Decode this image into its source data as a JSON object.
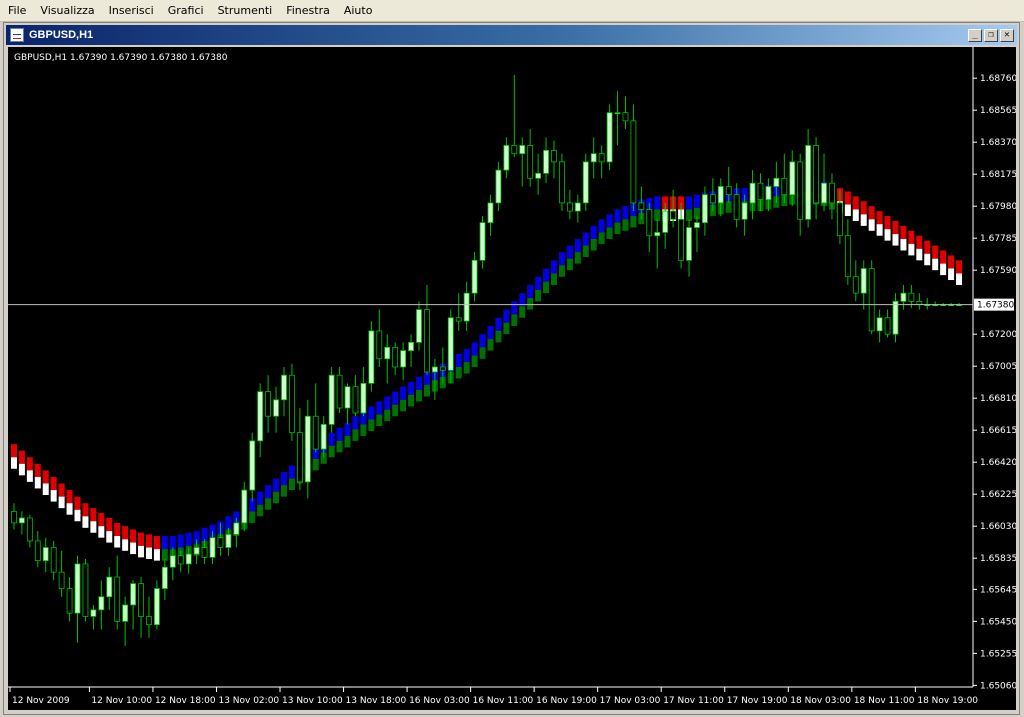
{
  "menu": {
    "items": [
      {
        "label": "File",
        "name": "menu-file"
      },
      {
        "label": "Visualizza",
        "name": "menu-visualizza"
      },
      {
        "label": "Inserisci",
        "name": "menu-inserisci"
      },
      {
        "label": "Grafici",
        "name": "menu-grafici"
      },
      {
        "label": "Strumenti",
        "name": "menu-strumenti"
      },
      {
        "label": "Finestra",
        "name": "menu-finestra"
      },
      {
        "label": "Aiuto",
        "name": "menu-aiuto"
      }
    ]
  },
  "window": {
    "title": "GBPUSD,H1",
    "minimize_label": "_",
    "restore_label": "❐",
    "close_label": "✕",
    "icon": "chart-window-icon"
  },
  "chart_data": {
    "type": "candlestick",
    "symbol_label": "GBPUSD,H1",
    "info_line": "GBPUSD,H1  1.67390 1.67390 1.67380 1.67380",
    "current_price": "1.67380",
    "current_price_value": 1.6738,
    "ylim": [
      1.6505,
      1.6895
    ],
    "y_ticks": [
      {
        "label": "1.68760",
        "value": 1.6876
      },
      {
        "label": "1.68565",
        "value": 1.68565
      },
      {
        "label": "1.68370",
        "value": 1.6837
      },
      {
        "label": "1.68175",
        "value": 1.68175
      },
      {
        "label": "1.67980",
        "value": 1.6798
      },
      {
        "label": "1.67785",
        "value": 1.67785
      },
      {
        "label": "1.67590",
        "value": 1.6759
      },
      {
        "label": "1.67200",
        "value": 1.672
      },
      {
        "label": "1.67005",
        "value": 1.67005
      },
      {
        "label": "1.66810",
        "value": 1.6681
      },
      {
        "label": "1.66615",
        "value": 1.66615
      },
      {
        "label": "1.66420",
        "value": 1.6642
      },
      {
        "label": "1.66225",
        "value": 1.66225
      },
      {
        "label": "1.66030",
        "value": 1.6603
      },
      {
        "label": "1.65835",
        "value": 1.65835
      },
      {
        "label": "1.65645",
        "value": 1.65645
      },
      {
        "label": "1.65450",
        "value": 1.6545
      },
      {
        "label": "1.65255",
        "value": 1.65255
      },
      {
        "label": "1.65060",
        "value": 1.6506
      }
    ],
    "x_ticks": [
      {
        "label": "12 Nov 2009",
        "bar": 0
      },
      {
        "label": "12 Nov 10:00",
        "bar": 10
      },
      {
        "label": "12 Nov 18:00",
        "bar": 18
      },
      {
        "label": "13 Nov 02:00",
        "bar": 26
      },
      {
        "label": "13 Nov 10:00",
        "bar": 34
      },
      {
        "label": "13 Nov 18:00",
        "bar": 42
      },
      {
        "label": "16 Nov 03:00",
        "bar": 50
      },
      {
        "label": "16 Nov 11:00",
        "bar": 58
      },
      {
        "label": "16 Nov 19:00",
        "bar": 66
      },
      {
        "label": "17 Nov 03:00",
        "bar": 74
      },
      {
        "label": "17 Nov 11:00",
        "bar": 82
      },
      {
        "label": "17 Nov 19:00",
        "bar": 90
      },
      {
        "label": "18 Nov 03:00",
        "bar": 98
      },
      {
        "label": "18 Nov 11:00",
        "bar": 106
      },
      {
        "label": "18 Nov 19:00",
        "bar": 114
      }
    ],
    "bar_count": 120,
    "colors": {
      "background": "#000000",
      "candle_wick": "#00c000",
      "bull_body": "#ccffcc",
      "bear_body": "#000000",
      "band_red": "#e00000",
      "band_blue": "#0000e0",
      "band_green": "#007000",
      "band_white": "#ffffff",
      "axis_text": "#ffffff",
      "price_line": "#c0c0c0"
    },
    "candles": [
      [
        1.6612,
        1.6617,
        1.6601,
        1.6605
      ],
      [
        1.6605,
        1.6612,
        1.6598,
        1.6608
      ],
      [
        1.6608,
        1.661,
        1.659,
        1.6594
      ],
      [
        1.6594,
        1.66,
        1.6578,
        1.6582
      ],
      [
        1.6582,
        1.6596,
        1.6575,
        1.659
      ],
      [
        1.659,
        1.6594,
        1.657,
        1.6575
      ],
      [
        1.6575,
        1.6588,
        1.656,
        1.6565
      ],
      [
        1.6565,
        1.6572,
        1.6545,
        1.655
      ],
      [
        1.655,
        1.6585,
        1.6532,
        1.658
      ],
      [
        1.658,
        1.6583,
        1.6545,
        1.6548
      ],
      [
        1.6548,
        1.6555,
        1.654,
        1.6552
      ],
      [
        1.6552,
        1.657,
        1.654,
        1.656
      ],
      [
        1.656,
        1.6578,
        1.6552,
        1.6572
      ],
      [
        1.6572,
        1.6585,
        1.654,
        1.6545
      ],
      [
        1.6545,
        1.656,
        1.653,
        1.6555
      ],
      [
        1.6555,
        1.657,
        1.654,
        1.6568
      ],
      [
        1.6568,
        1.6572,
        1.6535,
        1.6548
      ],
      [
        1.6548,
        1.656,
        1.6535,
        1.6543
      ],
      [
        1.6543,
        1.657,
        1.654,
        1.6565
      ],
      [
        1.6565,
        1.6583,
        1.6558,
        1.6578
      ],
      [
        1.6578,
        1.659,
        1.657,
        1.6585
      ],
      [
        1.6585,
        1.6588,
        1.6575,
        1.658
      ],
      [
        1.658,
        1.659,
        1.6574,
        1.6586
      ],
      [
        1.6586,
        1.6595,
        1.658,
        1.659
      ],
      [
        1.659,
        1.6595,
        1.658,
        1.6584
      ],
      [
        1.6584,
        1.66,
        1.658,
        1.6596
      ],
      [
        1.6596,
        1.6605,
        1.6585,
        1.659
      ],
      [
        1.659,
        1.6602,
        1.6585,
        1.6598
      ],
      [
        1.6598,
        1.6608,
        1.659,
        1.6605
      ],
      [
        1.6605,
        1.663,
        1.66,
        1.6625
      ],
      [
        1.6625,
        1.666,
        1.6618,
        1.6655
      ],
      [
        1.6655,
        1.669,
        1.6645,
        1.6685
      ],
      [
        1.6685,
        1.6695,
        1.666,
        1.667
      ],
      [
        1.667,
        1.6688,
        1.666,
        1.668
      ],
      [
        1.668,
        1.67,
        1.667,
        1.6695
      ],
      [
        1.6695,
        1.6702,
        1.6655,
        1.666
      ],
      [
        1.666,
        1.6675,
        1.6625,
        1.663
      ],
      [
        1.663,
        1.668,
        1.662,
        1.667
      ],
      [
        1.667,
        1.669,
        1.6648,
        1.665
      ],
      [
        1.665,
        1.667,
        1.6645,
        1.6665
      ],
      [
        1.6665,
        1.67,
        1.666,
        1.6695
      ],
      [
        1.6695,
        1.67,
        1.6672,
        1.6675
      ],
      [
        1.6675,
        1.669,
        1.6665,
        1.6688
      ],
      [
        1.6688,
        1.6695,
        1.667,
        1.6672
      ],
      [
        1.6672,
        1.67,
        1.667,
        1.669
      ],
      [
        1.669,
        1.6728,
        1.6685,
        1.6722
      ],
      [
        1.6722,
        1.6735,
        1.67,
        1.6705
      ],
      [
        1.6705,
        1.672,
        1.669,
        1.6712
      ],
      [
        1.6712,
        1.6715,
        1.6695,
        1.67
      ],
      [
        1.67,
        1.6715,
        1.6692,
        1.671
      ],
      [
        1.671,
        1.672,
        1.67,
        1.6715
      ],
      [
        1.6715,
        1.674,
        1.671,
        1.6735
      ],
      [
        1.6735,
        1.675,
        1.6695,
        1.6697
      ],
      [
        1.6697,
        1.6705,
        1.668,
        1.67
      ],
      [
        1.67,
        1.6712,
        1.669,
        1.6698
      ],
      [
        1.6698,
        1.6735,
        1.669,
        1.673
      ],
      [
        1.673,
        1.6745,
        1.6722,
        1.6728
      ],
      [
        1.6728,
        1.6752,
        1.6722,
        1.6745
      ],
      [
        1.6745,
        1.677,
        1.674,
        1.6765
      ],
      [
        1.6765,
        1.6792,
        1.676,
        1.6788
      ],
      [
        1.6788,
        1.6805,
        1.678,
        1.68
      ],
      [
        1.68,
        1.6825,
        1.6795,
        1.682
      ],
      [
        1.682,
        1.684,
        1.6815,
        1.6835
      ],
      [
        1.6835,
        1.6878,
        1.6828,
        1.683
      ],
      [
        1.683,
        1.684,
        1.681,
        1.6835
      ],
      [
        1.6835,
        1.6845,
        1.681,
        1.6815
      ],
      [
        1.6815,
        1.683,
        1.6805,
        1.6818
      ],
      [
        1.6818,
        1.684,
        1.6812,
        1.6832
      ],
      [
        1.6832,
        1.6838,
        1.6815,
        1.6825
      ],
      [
        1.6825,
        1.683,
        1.6795,
        1.68
      ],
      [
        1.68,
        1.6808,
        1.679,
        1.6795
      ],
      [
        1.6795,
        1.6805,
        1.6788,
        1.68
      ],
      [
        1.68,
        1.683,
        1.6795,
        1.6825
      ],
      [
        1.6825,
        1.684,
        1.6815,
        1.683
      ],
      [
        1.683,
        1.6835,
        1.6815,
        1.6825
      ],
      [
        1.6825,
        1.686,
        1.682,
        1.6855
      ],
      [
        1.6855,
        1.6868,
        1.6835,
        1.6855
      ],
      [
        1.6855,
        1.6865,
        1.6845,
        1.685
      ],
      [
        1.685,
        1.686,
        1.6795,
        1.68
      ],
      [
        1.68,
        1.681,
        1.679,
        1.6796
      ],
      [
        1.6796,
        1.68,
        1.677,
        1.678
      ],
      [
        1.678,
        1.679,
        1.676,
        1.6782
      ],
      [
        1.6782,
        1.68,
        1.6772,
        1.6795
      ],
      [
        1.6795,
        1.6808,
        1.6785,
        1.679
      ],
      [
        1.679,
        1.68,
        1.676,
        1.6765
      ],
      [
        1.6765,
        1.679,
        1.6755,
        1.6785
      ],
      [
        1.6785,
        1.6792,
        1.677,
        1.6788
      ],
      [
        1.6788,
        1.681,
        1.678,
        1.6805
      ],
      [
        1.6805,
        1.6815,
        1.6795,
        1.68
      ],
      [
        1.68,
        1.6815,
        1.6792,
        1.681
      ],
      [
        1.681,
        1.6822,
        1.68,
        1.6805
      ],
      [
        1.6805,
        1.6812,
        1.6785,
        1.679
      ],
      [
        1.679,
        1.6805,
        1.678,
        1.68
      ],
      [
        1.68,
        1.682,
        1.679,
        1.6812
      ],
      [
        1.6812,
        1.6818,
        1.6795,
        1.6802
      ],
      [
        1.6802,
        1.6815,
        1.6795,
        1.681
      ],
      [
        1.681,
        1.6825,
        1.68,
        1.6815
      ],
      [
        1.6815,
        1.683,
        1.68,
        1.6805
      ],
      [
        1.6805,
        1.6832,
        1.6798,
        1.6825
      ],
      [
        1.6825,
        1.683,
        1.678,
        1.679
      ],
      [
        1.679,
        1.6845,
        1.6785,
        1.6835
      ],
      [
        1.6835,
        1.684,
        1.679,
        1.68
      ],
      [
        1.68,
        1.683,
        1.6795,
        1.6812
      ],
      [
        1.6812,
        1.6818,
        1.679,
        1.68
      ],
      [
        1.68,
        1.6808,
        1.6775,
        1.678
      ],
      [
        1.678,
        1.679,
        1.675,
        1.6755
      ],
      [
        1.6755,
        1.6765,
        1.674,
        1.6745
      ],
      [
        1.6745,
        1.6765,
        1.6735,
        1.676
      ],
      [
        1.676,
        1.6765,
        1.672,
        1.6722
      ],
      [
        1.6722,
        1.6735,
        1.6715,
        1.673
      ],
      [
        1.673,
        1.6735,
        1.6718,
        1.672
      ],
      [
        1.672,
        1.6745,
        1.6715,
        1.674
      ],
      [
        1.674,
        1.675,
        1.6735,
        1.6745
      ],
      [
        1.6745,
        1.675,
        1.6736,
        1.674
      ],
      [
        1.674,
        1.6745,
        1.6735,
        1.6738
      ],
      [
        1.6738,
        1.6742,
        1.6735,
        1.6738
      ],
      [
        1.6738,
        1.674,
        1.6737,
        1.6738
      ],
      [
        1.6738,
        1.6739,
        1.6738,
        1.6738
      ],
      [
        1.6738,
        1.6739,
        1.6738,
        1.6738
      ],
      [
        1.6738,
        1.6739,
        1.6738,
        1.6738
      ]
    ],
    "band_centers": [
      1.6645,
      1.6641,
      1.6637,
      1.6633,
      1.6629,
      1.6625,
      1.6621,
      1.6617,
      1.6613,
      1.6609,
      1.6606,
      1.6603,
      1.66,
      1.6597,
      1.6595,
      1.6593,
      1.6591,
      1.659,
      1.6589,
      1.6589,
      1.6589,
      1.659,
      1.6591,
      1.6592,
      1.6594,
      1.6596,
      1.6598,
      1.6601,
      1.6604,
      1.6608,
      1.6612,
      1.6616,
      1.662,
      1.6624,
      1.6628,
      1.6632,
      1.6636,
      1.664,
      1.6644,
      1.6648,
      1.6652,
      1.6655,
      1.6658,
      1.6662,
      1.6665,
      1.6668,
      1.6671,
      1.6674,
      1.6677,
      1.668,
      1.6683,
      1.6686,
      1.6689,
      1.6692,
      1.6694,
      1.6697,
      1.67,
      1.6703,
      1.6707,
      1.6712,
      1.6717,
      1.6722,
      1.6727,
      1.6732,
      1.6737,
      1.6742,
      1.6747,
      1.6752,
      1.6757,
      1.6762,
      1.6766,
      1.677,
      1.6774,
      1.6778,
      1.6782,
      1.6785,
      1.6788,
      1.679,
      1.6792,
      1.6794,
      1.6795,
      1.6796,
      1.6796,
      1.6796,
      1.6796,
      1.6796,
      1.6797,
      1.6798,
      1.6799,
      1.68,
      1.6801,
      1.6801,
      1.6801,
      1.6802,
      1.6802,
      1.6803,
      1.6804,
      1.6805,
      1.6806,
      1.6807,
      1.6807,
      1.6806,
      1.6805,
      1.6803,
      1.6801,
      1.6799,
      1.6796,
      1.6793,
      1.679,
      1.6787,
      1.6784,
      1.6781,
      1.6778,
      1.6775,
      1.6772,
      1.6769,
      1.6766,
      1.6763,
      1.676,
      1.6757
    ],
    "band_colors": [
      "red",
      "red",
      "red",
      "red",
      "red",
      "red",
      "red",
      "red",
      "red",
      "red",
      "red",
      "red",
      "red",
      "red",
      "red",
      "red",
      "red",
      "red",
      "red",
      "blue",
      "blue",
      "blue",
      "blue",
      "blue",
      "blue",
      "blue",
      "blue",
      "blue",
      "blue",
      "blue",
      "blue",
      "blue",
      "blue",
      "blue",
      "blue",
      "blue",
      "blue",
      "blue",
      "blue",
      "blue",
      "blue",
      "blue",
      "blue",
      "blue",
      "blue",
      "blue",
      "blue",
      "blue",
      "blue",
      "blue",
      "blue",
      "blue",
      "blue",
      "blue",
      "blue",
      "blue",
      "blue",
      "blue",
      "blue",
      "blue",
      "blue",
      "blue",
      "blue",
      "blue",
      "blue",
      "blue",
      "blue",
      "blue",
      "blue",
      "blue",
      "blue",
      "blue",
      "blue",
      "blue",
      "blue",
      "blue",
      "blue",
      "blue",
      "blue",
      "blue",
      "blue",
      "blue",
      "red",
      "red",
      "red",
      "blue",
      "blue",
      "blue",
      "blue",
      "blue",
      "blue",
      "blue",
      "blue",
      "blue",
      "blue",
      "blue",
      "blue",
      "blue",
      "blue",
      "blue",
      "blue",
      "blue",
      "blue",
      "blue",
      "red",
      "red",
      "red",
      "red",
      "red",
      "red",
      "red",
      "red",
      "red",
      "red",
      "red",
      "red",
      "red",
      "red",
      "red",
      "red"
    ]
  }
}
